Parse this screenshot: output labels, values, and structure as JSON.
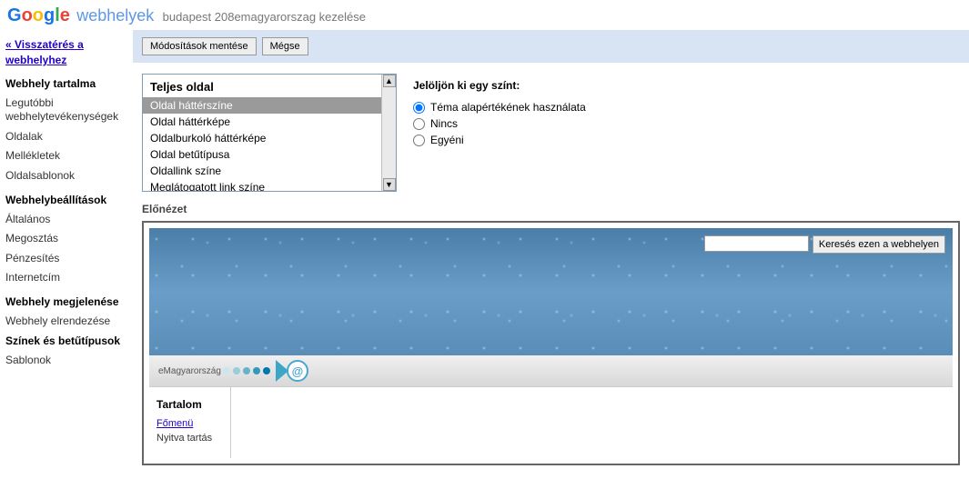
{
  "header": {
    "product": "webhelyek",
    "site_title": "budapest 208emagyarorszag kezelése"
  },
  "sidebar": {
    "back_link": "« Visszatérés a webhelyhez",
    "sections": [
      {
        "title": "Webhely tartalma",
        "items": [
          {
            "label": "Legutóbbi webhelytevékenységek",
            "selected": false
          },
          {
            "label": "Oldalak",
            "selected": false
          },
          {
            "label": "Mellékletek",
            "selected": false
          },
          {
            "label": "Oldalsablonok",
            "selected": false
          }
        ]
      },
      {
        "title": "Webhelybeállítások",
        "items": [
          {
            "label": "Általános",
            "selected": false
          },
          {
            "label": "Megosztás",
            "selected": false
          },
          {
            "label": "Pénzesítés",
            "selected": false
          },
          {
            "label": "Internetcím",
            "selected": false
          }
        ]
      },
      {
        "title": "Webhely megjelenése",
        "items": [
          {
            "label": "Webhely elrendezése",
            "selected": false
          },
          {
            "label": "Színek és betűtípusok",
            "selected": true
          },
          {
            "label": "Sablonok",
            "selected": false
          }
        ]
      }
    ]
  },
  "toolbar": {
    "save": "Módosítások mentése",
    "cancel": "Mégse"
  },
  "listbox": {
    "header": "Teljes oldal",
    "items": [
      {
        "label": "Oldal háttérszíne",
        "selected": true
      },
      {
        "label": "Oldal háttérképe",
        "selected": false
      },
      {
        "label": "Oldalburkoló háttérképe",
        "selected": false
      },
      {
        "label": "Oldal betűtípusa",
        "selected": false
      },
      {
        "label": "Oldallink színe",
        "selected": false
      },
      {
        "label": "Meglátogatott link színe",
        "selected": false
      }
    ]
  },
  "color_panel": {
    "title": "Jelöljön ki egy színt:",
    "options": [
      {
        "label": "Téma alapértékének használata",
        "checked": true
      },
      {
        "label": "Nincs",
        "checked": false
      },
      {
        "label": "Egyéni",
        "checked": false
      }
    ]
  },
  "preview": {
    "label": "Előnézet",
    "search_button": "Keresés ezen a webhelyen",
    "logo_text": "eMagyarország",
    "side_title": "Tartalom",
    "link1": "Főmenü",
    "text1": "Nyitva tartás"
  }
}
